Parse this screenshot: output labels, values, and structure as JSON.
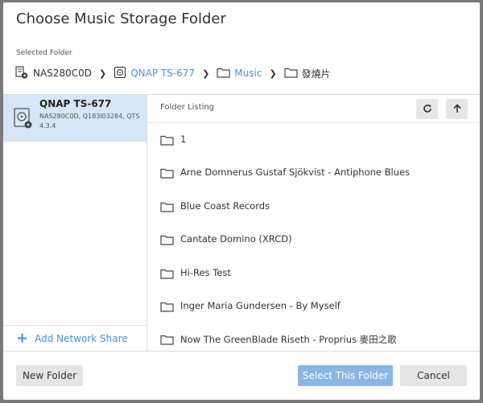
{
  "dialog": {
    "title": "Choose Music Storage Folder",
    "selected_label": "Selected Folder"
  },
  "breadcrumb": [
    {
      "label": "NAS280C0D",
      "icon": "nas-icon"
    },
    {
      "label": "QNAP TS-677",
      "icon": "drive-icon"
    },
    {
      "label": "Music",
      "icon": "folder-icon"
    },
    {
      "label": "發燒片",
      "icon": "folder-icon"
    }
  ],
  "device": {
    "name": "QNAP TS-677",
    "details": "NAS280C0D, Q183I03284, QTS 4.3.4"
  },
  "add_share_label": "Add Network Share",
  "listing": {
    "header": "Folder Listing",
    "items": [
      "1",
      "Arne Domnerus Gustaf Sjökvist - Antiphone Blues",
      "Blue Coast Records",
      "Cantate Domino (XRCD)",
      "Hi-Res Test",
      "Inger Maria Gundersen - By Myself",
      "Now The GreenBlade Riseth - Proprius 麥田之歌"
    ]
  },
  "buttons": {
    "new_folder": "New Folder",
    "select": "Select This Folder",
    "cancel": "Cancel"
  },
  "colors": {
    "accent": "#4a90d9",
    "selected_bg": "#d6e6f7",
    "primary_button": "#8ab6e6"
  }
}
